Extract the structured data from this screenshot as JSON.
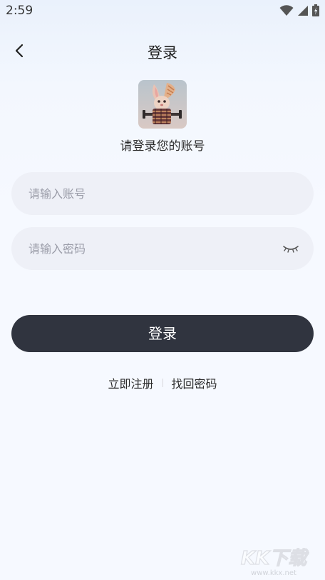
{
  "status_bar": {
    "time": "2:59"
  },
  "header": {
    "title": "登录"
  },
  "subtitle": "请登录您的账号",
  "form": {
    "account_placeholder": "请输入账号",
    "account_value": "",
    "password_placeholder": "请输入密码",
    "password_value": ""
  },
  "login_button_label": "登录",
  "links": {
    "register": "立即注册",
    "recover": "找回密码"
  },
  "watermark": {
    "brand": "KK下载",
    "url": "www.kkx.net"
  },
  "colors": {
    "primary_button": "#30343f",
    "input_background": "#eef0f7",
    "page_background": "#f6f9ff"
  }
}
